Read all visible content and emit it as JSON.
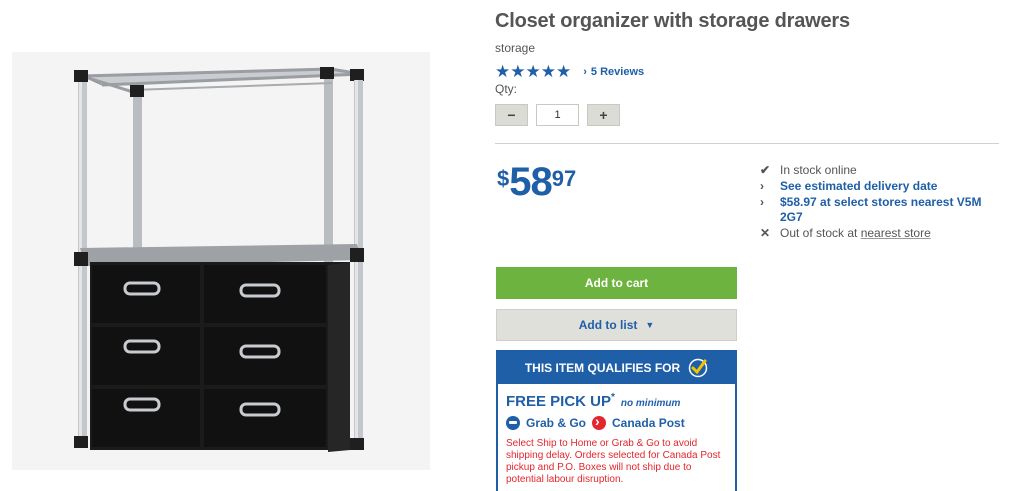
{
  "product": {
    "title": "Closet organizer with storage drawers",
    "category": "storage",
    "rating_stars": 5,
    "reviews_link": "5 Reviews"
  },
  "quantity": {
    "label": "Qty:",
    "value": "1",
    "minus": "−",
    "plus": "+"
  },
  "price": {
    "currency": "$",
    "dollars": "58",
    "cents": "97"
  },
  "stock": [
    {
      "icon": "check-icon",
      "glyph": "✔",
      "text": "In stock online"
    },
    {
      "icon": "chevron-right-icon",
      "glyph": "›",
      "text": "See estimated delivery date"
    },
    {
      "icon": "chevron-right-icon",
      "glyph": "›",
      "text": "$58.97 at select stores nearest V5M 2G7"
    },
    {
      "icon": "x-icon",
      "glyph": "✕",
      "text_prefix": "Out of stock at ",
      "text_link": "nearest store"
    }
  ],
  "buttons": {
    "add_to_cart": "Add to cart",
    "add_to_list": "Add to list",
    "caret": "▼"
  },
  "promo": {
    "header": "THIS ITEM QUALIFIES FOR",
    "pickup": "FREE PICK UP",
    "pickup_mark": "*",
    "no_minimum": "no minimum",
    "method_1": "Grab & Go",
    "method_2": "Canada Post",
    "notice": "Select Ship to Home or Grab & Go to avoid shipping delay. Orders selected for Canada Post pickup and P.O. Boxes will not ship due to potential labour disruption."
  },
  "colors": {
    "brand_blue": "#1f5fa8",
    "cart_green": "#6db33f",
    "alert_red": "#e3262d"
  }
}
